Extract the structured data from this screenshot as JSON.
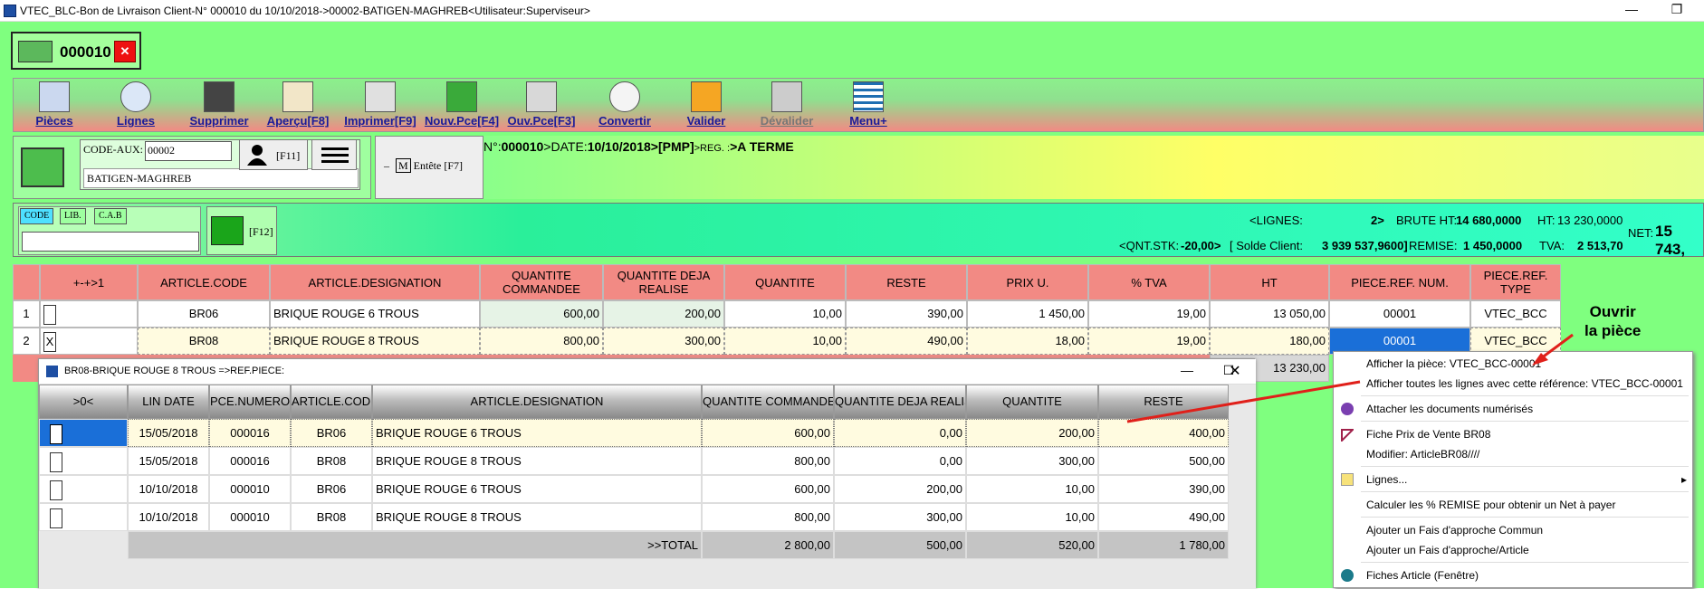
{
  "window": {
    "title": "VTEC_BLC-Bon de Livraison Client-N° 000010 du 10/10/2018->00002-BATIGEN-MAGHREB<Utilisateur:Superviseur>"
  },
  "doc_tab": {
    "number": "000010"
  },
  "toolbar": [
    {
      "label": "Pièces",
      "icon": "pieces-grid-icon"
    },
    {
      "label": "Lignes",
      "icon": "magnifier-icon"
    },
    {
      "label": "Supprimer",
      "icon": "trash-icon"
    },
    {
      "label": "Aperçu[F8]",
      "icon": "preview-icon"
    },
    {
      "label": "Imprimer[F9]",
      "icon": "printer-icon"
    },
    {
      "label": "Nouv.Pce[F4]",
      "icon": "new-piece-icon"
    },
    {
      "label": "Ouv.Pce[F3]",
      "icon": "open-piece-icon"
    },
    {
      "label": "Convertir",
      "icon": "convert-icon"
    },
    {
      "label": "Valider",
      "icon": "validate-icon"
    },
    {
      "label": "Dévalider",
      "icon": "devalidate-icon"
    },
    {
      "label": "Menu+",
      "icon": "menu-icon"
    }
  ],
  "client": {
    "code_label": "CODE-AUX:",
    "code_value": "00002",
    "name": "BATIGEN-MAGHREB",
    "person_key": "[F11]"
  },
  "entete": {
    "label": "Entête [F7]"
  },
  "doc_info": {
    "n_label": "N°:",
    "n_value": "000010",
    "date_label": ">DATE:",
    "date_value": "10/10/2018",
    "pmp": ">[PMP]",
    "reg_label": ">REG. :",
    "reg_value": ">A TERME"
  },
  "search": {
    "buttons": [
      "CODE",
      "LIB.",
      "C.A.B"
    ],
    "cart_key": "[F12]"
  },
  "stats": {
    "lignes_label": "<LIGNES:",
    "lignes_value": "2>",
    "brute_label": "BRUTE HT:",
    "brute_value": "14 680,0000",
    "ht_label": "HT:",
    "ht_value": "13 230,0000",
    "qnt_stk_label": "<QNT.STK:",
    "qnt_stk_value": "-20,00>",
    "solde_label": "[ Solde Client:",
    "solde_value": "3 939 537,9600]",
    "remise_label": "REMISE:",
    "remise_value": "1 450,0000",
    "tva_label": "TVA:",
    "tva_value": "2 513,70",
    "net_label": "NET:",
    "net_value": "15 743,"
  },
  "grid": {
    "headers": [
      "",
      "+-+>1",
      "ARTICLE.CODE",
      "ARTICLE.DESIGNATION",
      "QUANTITE COMMANDEE",
      "QUANTITE DEJA REALISE",
      "QUANTITE",
      "RESTE",
      "PRIX U.",
      "% TVA",
      "HT",
      "PIECE.REF. NUM.",
      "PIECE.REF. TYPE"
    ],
    "rows": [
      {
        "n": "1",
        "chk": "",
        "code": "BR06",
        "designation": "BRIQUE ROUGE 6 TROUS",
        "qte_cmd": "600,00",
        "qte_real": "200,00",
        "qte": "10,00",
        "reste": "390,00",
        "prix": "1 450,00",
        "tva": "19,00",
        "ht": "13 050,00",
        "ref_num": "00001",
        "ref_type": "VTEC_BCC"
      },
      {
        "n": "2",
        "chk": "X",
        "code": "BR08",
        "designation": "BRIQUE ROUGE 8 TROUS",
        "qte_cmd": "800,00",
        "qte_real": "300,00",
        "qte": "10,00",
        "reste": "490,00",
        "prix": "18,00",
        "tva": "19,00",
        "ht": "180,00",
        "ref_num": "00001",
        "ref_type": "VTEC_BCC"
      }
    ],
    "total_ht": "13 230,00"
  },
  "popup": {
    "title": "BR08-BRIQUE ROUGE 8 TROUS =>REF.PIECE:",
    "headers": [
      ">0<",
      "LIN DATE",
      "PCE.NUMERO",
      "ARTICLE.CODE",
      "ARTICLE.DESIGNATION",
      "QUANTITE COMMANDEE",
      "QUANTITE DEJA REALISE",
      "QUANTITE",
      "RESTE"
    ],
    "rows": [
      {
        "date": "15/05/2018",
        "num": "000016",
        "code": "BR06",
        "designation": "BRIQUE ROUGE 6 TROUS",
        "cmd": "600,00",
        "real": "0,00",
        "qte": "200,00",
        "reste": "400,00"
      },
      {
        "date": "15/05/2018",
        "num": "000016",
        "code": "BR08",
        "designation": "BRIQUE ROUGE 8 TROUS",
        "cmd": "800,00",
        "real": "0,00",
        "qte": "300,00",
        "reste": "500,00"
      },
      {
        "date": "10/10/2018",
        "num": "000010",
        "code": "BR06",
        "designation": "BRIQUE ROUGE 6 TROUS",
        "cmd": "600,00",
        "real": "200,00",
        "qte": "10,00",
        "reste": "390,00"
      },
      {
        "date": "10/10/2018",
        "num": "000010",
        "code": "BR08",
        "designation": "BRIQUE ROUGE 8 TROUS",
        "cmd": "800,00",
        "real": "300,00",
        "qte": "10,00",
        "reste": "490,00"
      }
    ],
    "total_label": ">>TOTAL",
    "total_cmd": "2 800,00",
    "total_real": "500,00",
    "total_qte": "520,00",
    "total_reste": "1 780,00"
  },
  "context_menu": {
    "items": [
      "Afficher la pièce: VTEC_BCC-00001",
      "Afficher toutes les lignes avec cette référence: VTEC_BCC-00001",
      "Attacher les documents numérisés",
      "Fiche Prix de Vente BR08",
      "Modifier: ArticleBR08////",
      "Lignes...",
      "Calculer les % REMISE pour obtenir un Net à payer",
      "Ajouter un Fais d'approche Commun",
      "Ajouter un Fais d'approche/Article",
      "Fiches Article (Fenêtre)"
    ]
  },
  "annotation": {
    "line1": "Ouvrir",
    "line2": "la pièce"
  }
}
